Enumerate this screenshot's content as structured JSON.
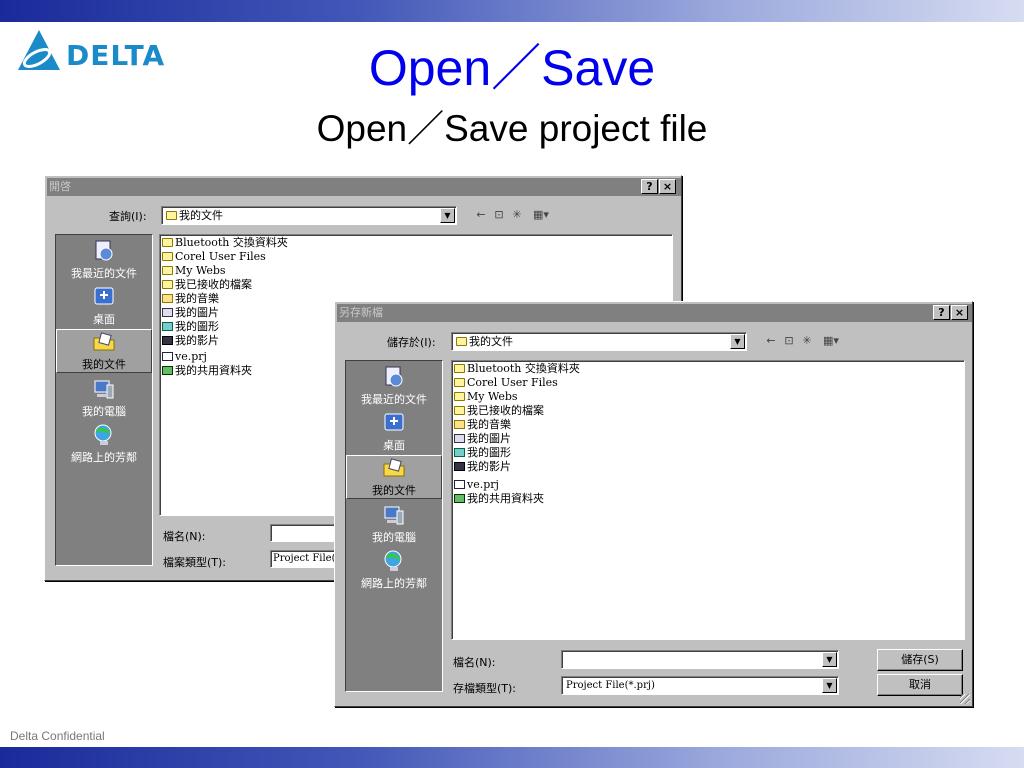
{
  "slide": {
    "logo_text": "DELTA",
    "title": "Open／Save",
    "subtitle": "Open／Save project file",
    "footer": "Delta Confidential"
  },
  "open_dialog": {
    "title": "開啓",
    "help_btn": "?",
    "close_btn": "×",
    "lookin_label": "查詢(I):",
    "lookin_value": "我的文件",
    "places": [
      {
        "label": "我最近的文件",
        "icon": "recent-icon"
      },
      {
        "label": "桌面",
        "icon": "desktop-icon"
      },
      {
        "label": "我的文件",
        "icon": "my-documents-icon"
      },
      {
        "label": "我的電腦",
        "icon": "my-computer-icon"
      },
      {
        "label": "網路上的芳鄰",
        "icon": "network-icon"
      }
    ],
    "files": [
      {
        "name": "Bluetooth 交換資料夾",
        "icon": "folder"
      },
      {
        "name": "Corel User Files",
        "icon": "folder"
      },
      {
        "name": "My Webs",
        "icon": "folder"
      },
      {
        "name": "我已接收的檔案",
        "icon": "folder"
      },
      {
        "name": "我的音樂",
        "icon": "music"
      },
      {
        "name": "我的圖片",
        "icon": "pic"
      },
      {
        "name": "我的圖形",
        "icon": "shape"
      },
      {
        "name": "我的影片",
        "icon": "video"
      },
      {
        "name": "ve.prj",
        "icon": "prj"
      },
      {
        "name": "我的共用資料夾",
        "icon": "shared"
      }
    ],
    "filename_label": "檔名(N):",
    "filename_value": "",
    "filetype_label": "檔案類型(T):",
    "filetype_value": "Project File(*.prj)"
  },
  "save_dialog": {
    "title": "另存新檔",
    "help_btn": "?",
    "close_btn": "×",
    "savein_label": "儲存於(I):",
    "savein_value": "我的文件",
    "places": [
      {
        "label": "我最近的文件",
        "icon": "recent-icon"
      },
      {
        "label": "桌面",
        "icon": "desktop-icon"
      },
      {
        "label": "我的文件",
        "icon": "my-documents-icon"
      },
      {
        "label": "我的電腦",
        "icon": "my-computer-icon"
      },
      {
        "label": "網路上的芳鄰",
        "icon": "network-icon"
      }
    ],
    "files": [
      {
        "name": "Bluetooth 交換資料夾",
        "icon": "folder"
      },
      {
        "name": "Corel User Files",
        "icon": "folder"
      },
      {
        "name": "My Webs",
        "icon": "folder"
      },
      {
        "name": "我已接收的檔案",
        "icon": "folder"
      },
      {
        "name": "我的音樂",
        "icon": "music"
      },
      {
        "name": "我的圖片",
        "icon": "pic"
      },
      {
        "name": "我的圖形",
        "icon": "shape"
      },
      {
        "name": "我的影片",
        "icon": "video"
      },
      {
        "name": "ve.prj",
        "icon": "prj"
      },
      {
        "name": "我的共用資料夾",
        "icon": "shared"
      }
    ],
    "filename_label": "檔名(N):",
    "filename_value": "",
    "filetype_label": "存檔類型(T):",
    "filetype_value": "Project File(*.prj)",
    "save_btn": "儲存(S)",
    "cancel_btn": "取消"
  },
  "colors": {
    "title_blue": "#0000ee",
    "dialog_gray": "#c0c0c0",
    "places_gray": "#808080",
    "logo_blue": "#1b8ac8"
  }
}
